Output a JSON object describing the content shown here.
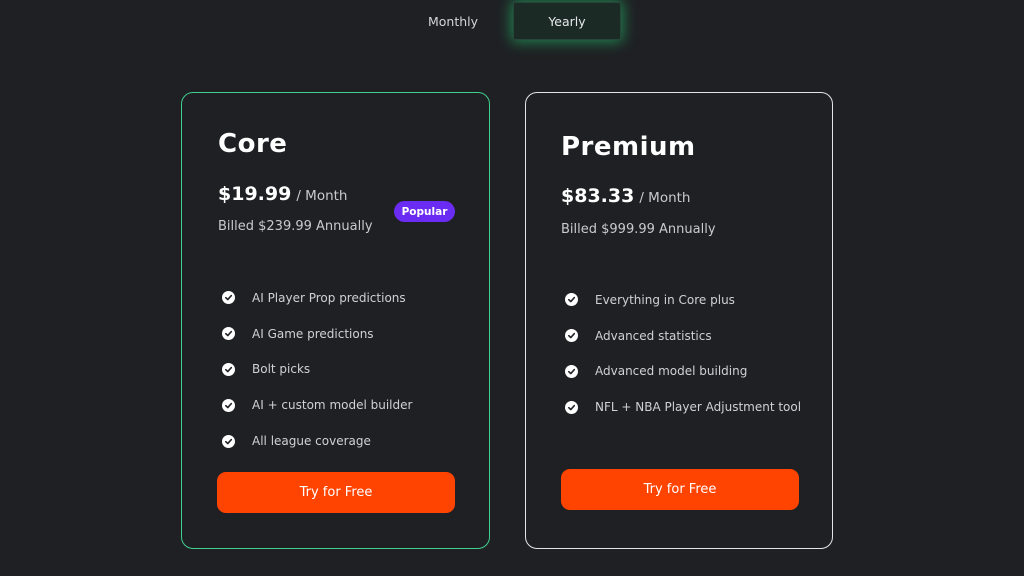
{
  "billing_toggle": {
    "monthly_label": "Monthly",
    "yearly_label": "Yearly",
    "selected": "Yearly"
  },
  "plans": [
    {
      "name": "Core",
      "price": "$19.99",
      "period": "/ Month",
      "billed": "Billed $239.99 Annually",
      "badge": "Popular",
      "features": [
        "AI Player Prop predictions",
        "AI Game predictions",
        "Bolt picks",
        "AI + custom model builder",
        "All league coverage"
      ],
      "cta_label": "Try for Free"
    },
    {
      "name": "Premium",
      "price": "$83.33",
      "period": "/ Month",
      "billed": "Billed $999.99 Annually",
      "features": [
        "Everything in Core plus",
        "Advanced statistics",
        "Advanced model building",
        "NFL + NBA Player Adjustment tool"
      ],
      "cta_label": "Try for Free"
    }
  ],
  "icons": {
    "feature_bullet": "check-circle-icon"
  },
  "colors": {
    "background": "#1f2023",
    "accent_orange": "#ff4300",
    "accent_green": "#3fcf8e",
    "badge_purple": "#6a2cf2"
  }
}
